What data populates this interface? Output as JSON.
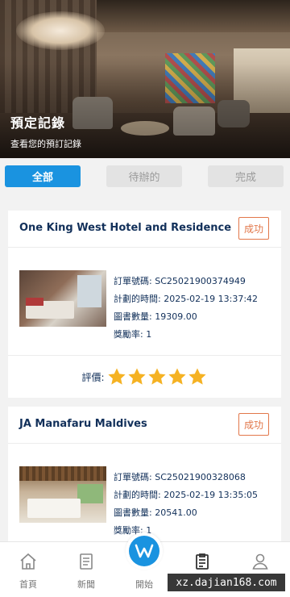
{
  "header": {
    "title": "預定記錄",
    "subtitle": "查看您的預訂記錄"
  },
  "tabs": [
    {
      "label": "全部",
      "active": true
    },
    {
      "label": "待辦的",
      "active": false
    },
    {
      "label": "完成",
      "active": false
    }
  ],
  "orders": [
    {
      "hotel": "One King West Hotel and Residence",
      "status": "成功",
      "order_no_label": "訂單號碼:",
      "order_no": "SC25021900374949",
      "time_label": "計劃的時間:",
      "time": "2025-02-19 13:37:42",
      "amount_label": "圖書數量:",
      "amount": "19309.00",
      "rate_label": "獎勵率:",
      "rate": "1",
      "rating_label": "評價:",
      "stars": 5
    },
    {
      "hotel": "JA Manafaru Maldives",
      "status": "成功",
      "order_no_label": "訂單號碼:",
      "order_no": "SC25021900328068",
      "time_label": "計劃的時間:",
      "time": "2025-02-19 13:35:05",
      "amount_label": "圖書數量:",
      "amount": "20541.00",
      "rate_label": "獎勵率:",
      "rate": "1"
    }
  ],
  "bottom_nav": [
    {
      "label": "首頁",
      "icon": "home-icon"
    },
    {
      "label": "新聞",
      "icon": "document-icon"
    },
    {
      "label": "開始",
      "icon": "start-logo-icon"
    },
    {
      "label": "",
      "icon": "clipboard-icon"
    },
    {
      "label": "",
      "icon": "user-icon"
    }
  ],
  "watermark": "xz.dajian168.com",
  "colors": {
    "accent": "#1a93e0",
    "status": "#e2774a",
    "star": "#f5b223",
    "title": "#12305a"
  }
}
